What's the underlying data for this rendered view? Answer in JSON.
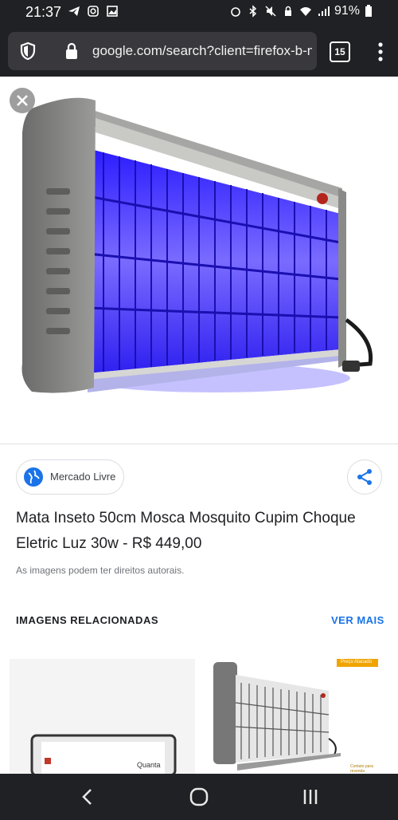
{
  "status_bar": {
    "time": "21:37",
    "battery": "91%"
  },
  "browser": {
    "url": "google.com/search?client=firefox-b-m&",
    "tab_count": "15"
  },
  "result": {
    "source": "Mercado Livre",
    "title": "Mata Inseto 50cm Mosca Mosquito Cupim Choque Eletric Luz 30w - R$ 449,00",
    "copyright": "As imagens podem ter direitos autorais."
  },
  "related": {
    "heading": "IMAGENS RELACIONADAS",
    "see_more": "VER MAIS",
    "thumb1_brand": "Quanta",
    "thumb2_badge": "Preço Atacado",
    "thumb2_caption": "Contato para revenda"
  },
  "icons": {
    "close": "close-icon",
    "shield": "shield-icon",
    "lock": "lock-icon",
    "share": "share-icon",
    "globe": "globe-icon",
    "back": "back-icon",
    "home": "home-icon",
    "recents": "recents-icon"
  }
}
